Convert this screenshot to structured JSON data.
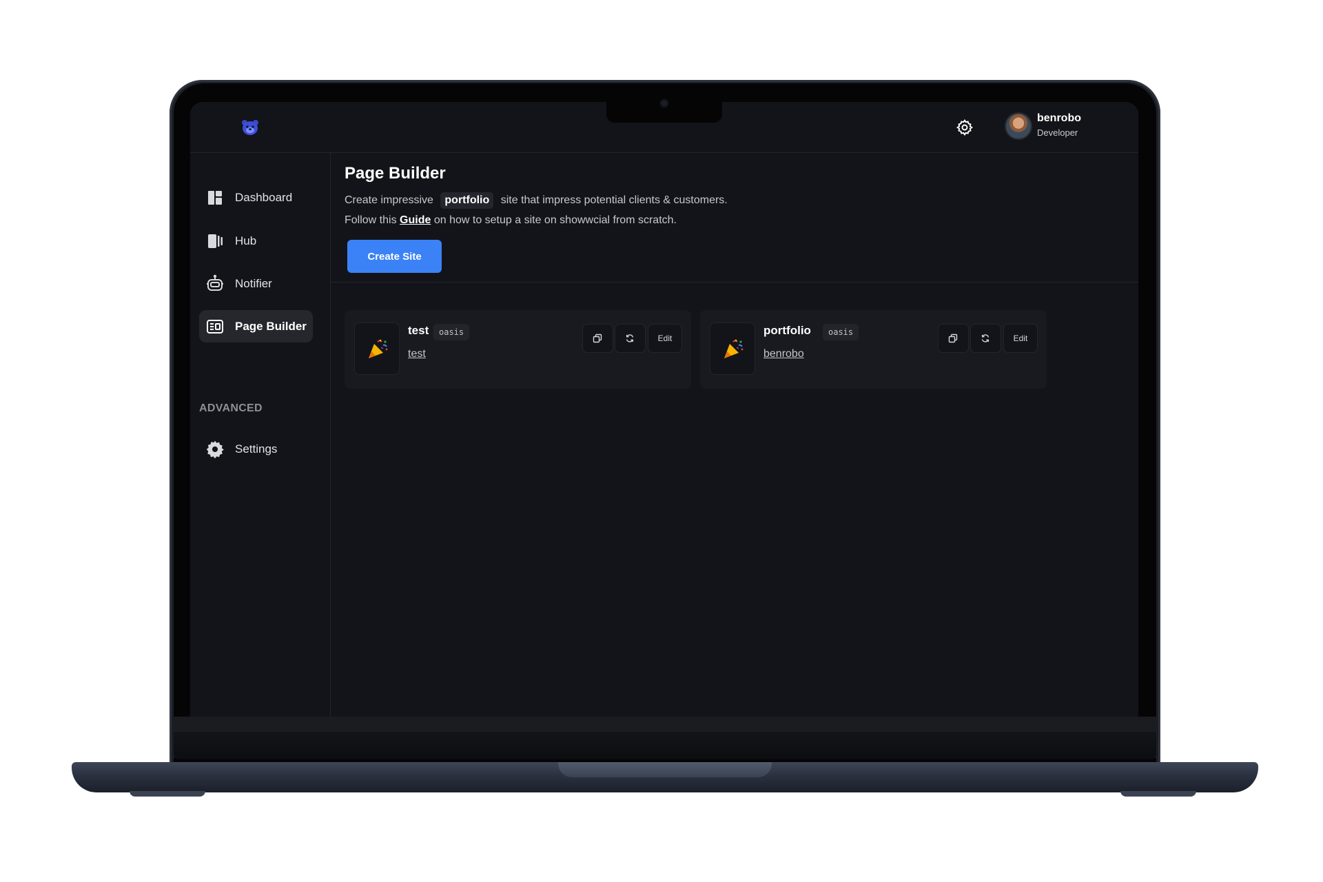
{
  "user": {
    "name": "benrobo",
    "role": "Developer"
  },
  "sidebar": {
    "items": [
      {
        "label": "Dashboard",
        "icon": "dashboard-icon"
      },
      {
        "label": "Hub",
        "icon": "hub-icon"
      },
      {
        "label": "Notifier",
        "icon": "robot-icon"
      },
      {
        "label": "Page Builder",
        "icon": "page-builder-icon",
        "active": true
      }
    ],
    "section_label": "ADVANCED",
    "advanced_items": [
      {
        "label": "Settings",
        "icon": "settings-gear-icon"
      }
    ]
  },
  "main": {
    "title": "Page Builder",
    "desc_before": "Create impressive",
    "desc_highlight": "portfolio",
    "desc_after": "site that impress potential clients & customers.",
    "guide_before": "Follow this",
    "guide_link": "Guide",
    "guide_after": "on how to setup a site on showwcial from scratch.",
    "create_button": "Create Site"
  },
  "sites": [
    {
      "name": "test",
      "template": "oasis",
      "link": "test",
      "thumbnail": "party-popper",
      "edit_label": "Edit"
    },
    {
      "name": "portfolio",
      "template": "oasis",
      "link": "benrobo",
      "thumbnail": "party-popper",
      "edit_label": "Edit"
    }
  ],
  "colors": {
    "accent": "#3b82f6",
    "background": "#131419",
    "card": "#191a20"
  }
}
